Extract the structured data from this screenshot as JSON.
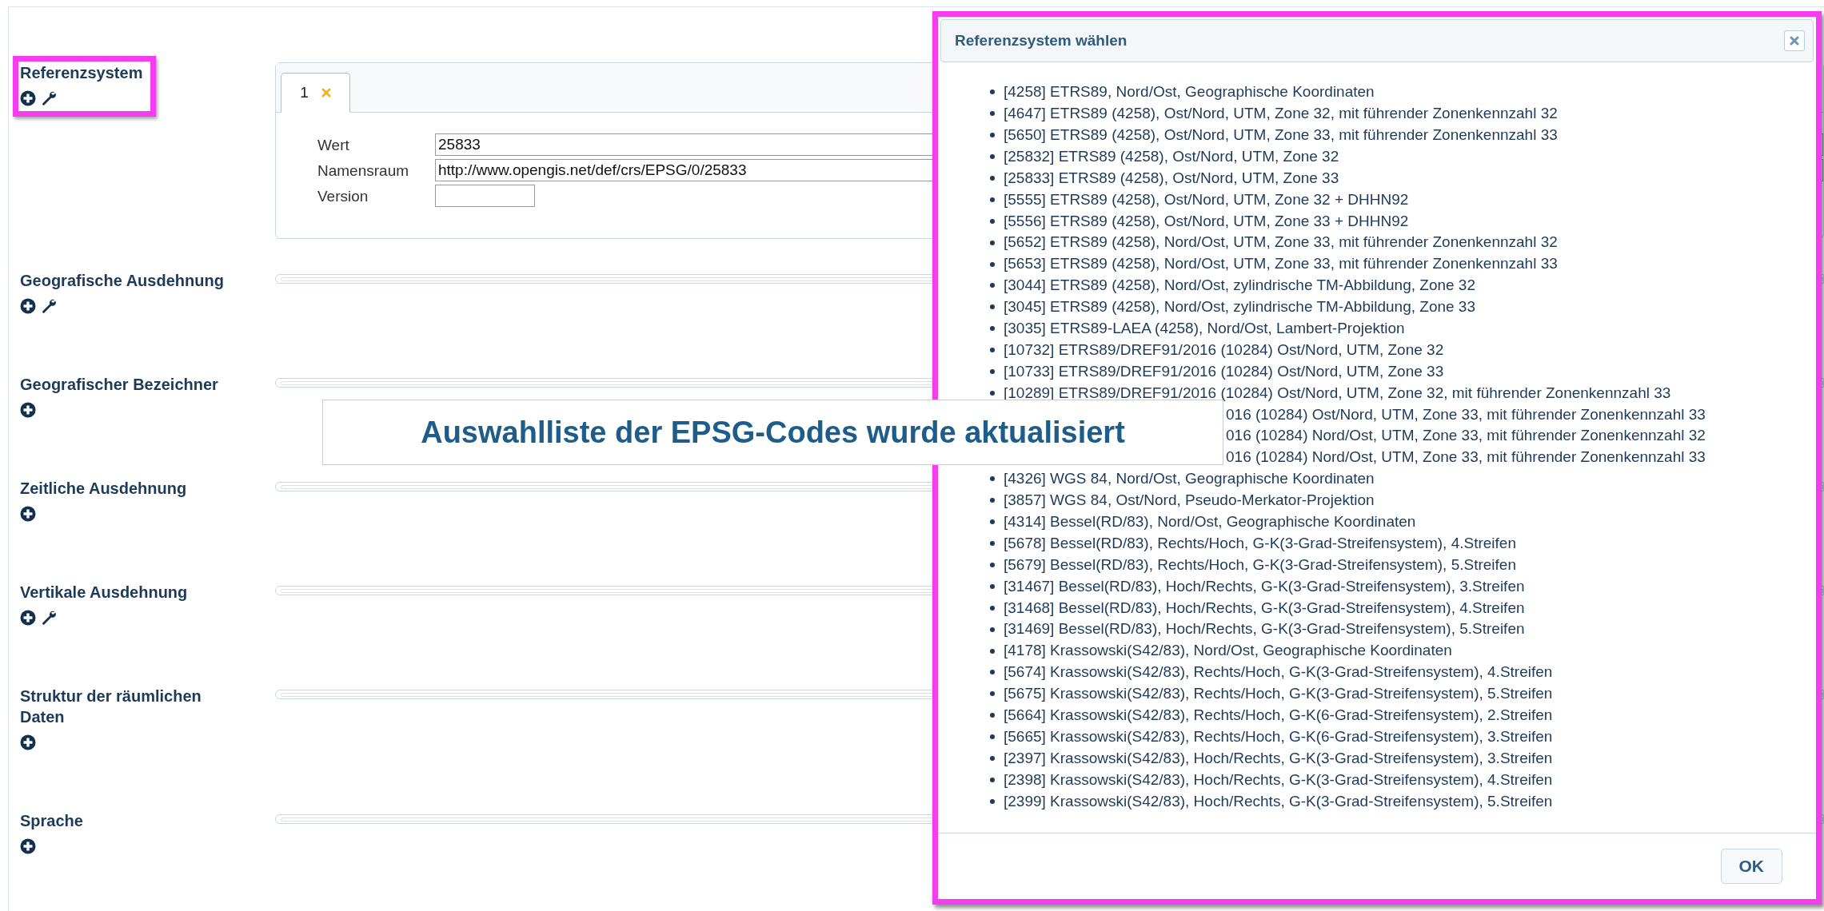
{
  "form": {
    "sections": [
      {
        "label": "Referenzsystem",
        "highlighted": true,
        "tools": [
          {
            "kind": "add"
          },
          {
            "kind": "edit"
          }
        ],
        "tabs": [
          {
            "label": "1",
            "selected": true
          }
        ],
        "fields": [
          {
            "label": "Wert",
            "value": "25833"
          },
          {
            "label": "Namensraum",
            "value": "http://www.opengis.net/def/crs/EPSG/0/25833"
          },
          {
            "label": "Version"
          }
        ]
      },
      {
        "label": "Geografische Ausdehnung",
        "highlighted": false,
        "tools": [
          {
            "kind": "add"
          },
          {
            "kind": "edit"
          }
        ]
      },
      {
        "label": "Geografischer Bezeichner",
        "highlighted": false,
        "tools": [
          {
            "kind": "add"
          }
        ]
      },
      {
        "label": "Zeitliche Ausdehnung",
        "highlighted": false,
        "tools": [
          {
            "kind": "add"
          }
        ]
      },
      {
        "label": "Vertikale Ausdehnung",
        "highlighted": false,
        "tools": [
          {
            "kind": "add"
          },
          {
            "kind": "edit"
          }
        ]
      },
      {
        "label": "Struktur der räumlichen Daten",
        "highlighted": false,
        "tools": [
          {
            "kind": "add"
          }
        ]
      },
      {
        "label": "Sprache",
        "highlighted": false,
        "tools": [
          {
            "kind": "add"
          }
        ]
      }
    ]
  },
  "dialog": {
    "title": "Referenzsystem wählen",
    "highlighted": true,
    "items": [
      {
        "kind": "entry",
        "text": "[4258] ETRS89, Nord/Ost, Geographische Koordinaten"
      },
      {
        "kind": "entry",
        "text": "[4647] ETRS89 (4258), Ost/Nord, UTM, Zone 32, mit führender Zonenkennzahl 32"
      },
      {
        "kind": "entry",
        "text": "[5650] ETRS89 (4258), Ost/Nord, UTM, Zone 33, mit führender Zonenkennzahl 33"
      },
      {
        "kind": "entry",
        "text": "[25832] ETRS89 (4258), Ost/Nord, UTM, Zone 32"
      },
      {
        "kind": "entry",
        "text": "[25833] ETRS89 (4258), Ost/Nord, UTM, Zone 33"
      },
      {
        "kind": "entry",
        "text": "[5555] ETRS89 (4258), Ost/Nord, UTM, Zone 32 + DHHN92"
      },
      {
        "kind": "entry",
        "text": "[5556] ETRS89 (4258), Ost/Nord, UTM, Zone 33 + DHHN92"
      },
      {
        "kind": "entry",
        "text": "[5652] ETRS89 (4258), Nord/Ost, UTM, Zone 33, mit führender Zonenkennzahl 32"
      },
      {
        "kind": "entry",
        "text": "[5653] ETRS89 (4258), Nord/Ost, UTM, Zone 33, mit führender Zonenkennzahl 33"
      },
      {
        "kind": "entry",
        "text": "[3044] ETRS89 (4258), Nord/Ost, zylindrische TM-Abbildung, Zone 32"
      },
      {
        "kind": "entry",
        "text": "[3045] ETRS89 (4258), Nord/Ost, zylindrische TM-Abbildung, Zone 33"
      },
      {
        "kind": "entry",
        "text": "[3035] ETRS89-LAEA (4258), Nord/Ost, Lambert-Projektion"
      },
      {
        "kind": "entry",
        "text": "[10732] ETRS89/DREF91/2016 (10284) Ost/Nord, UTM, Zone 32"
      },
      {
        "kind": "entry",
        "text": "[10733] ETRS89/DREF91/2016 (10284) Ost/Nord, UTM, Zone 33"
      },
      {
        "kind": "entry",
        "text": "[10289] ETRS89/DREF91/2016 (10284) Ost/Nord, UTM, Zone 32, mit führender Zonenkennzahl 33"
      },
      {
        "kind": "partial",
        "text": "016 (10284) Ost/Nord, UTM, Zone 33, mit führender Zonenkennzahl 33"
      },
      {
        "kind": "partial",
        "text": "016 (10284) Nord/Ost, UTM, Zone 33, mit führender Zonenkennzahl 32"
      },
      {
        "kind": "partial",
        "text": "016 (10284) Nord/Ost, UTM, Zone 33, mit führender Zonenkennzahl 33"
      },
      {
        "kind": "entry",
        "text": "[4326] WGS 84, Nord/Ost, Geographische Koordinaten"
      },
      {
        "kind": "entry",
        "text": "[3857] WGS 84, Ost/Nord, Pseudo-Merkator-Projektion"
      },
      {
        "kind": "entry",
        "text": "[4314] Bessel(RD/83), Nord/Ost, Geographische Koordinaten"
      },
      {
        "kind": "entry",
        "text": "[5678] Bessel(RD/83), Rechts/Hoch, G-K(3-Grad-Streifensystem), 4.Streifen"
      },
      {
        "kind": "entry",
        "text": "[5679] Bessel(RD/83), Rechts/Hoch, G-K(3-Grad-Streifensystem), 5.Streifen"
      },
      {
        "kind": "entry",
        "text": "[31467] Bessel(RD/83), Hoch/Rechts, G-K(3-Grad-Streifensystem), 3.Streifen"
      },
      {
        "kind": "entry",
        "text": "[31468] Bessel(RD/83), Hoch/Rechts, G-K(3-Grad-Streifensystem), 4.Streifen"
      },
      {
        "kind": "entry",
        "text": "[31469] Bessel(RD/83), Hoch/Rechts, G-K(3-Grad-Streifensystem), 5.Streifen"
      },
      {
        "kind": "entry",
        "text": "[4178] Krassowski(S42/83), Nord/Ost, Geographische Koordinaten"
      },
      {
        "kind": "entry",
        "text": "[5674] Krassowski(S42/83), Rechts/Hoch, G-K(3-Grad-Streifensystem), 4.Streifen"
      },
      {
        "kind": "entry",
        "text": "[5675] Krassowski(S42/83), Rechts/Hoch, G-K(3-Grad-Streifensystem), 5.Streifen"
      },
      {
        "kind": "entry",
        "text": "[5664] Krassowski(S42/83), Rechts/Hoch, G-K(6-Grad-Streifensystem), 2.Streifen"
      },
      {
        "kind": "entry",
        "text": "[5665] Krassowski(S42/83), Rechts/Hoch, G-K(6-Grad-Streifensystem), 3.Streifen"
      },
      {
        "kind": "entry",
        "text": "[2397] Krassowski(S42/83), Hoch/Rechts, G-K(3-Grad-Streifensystem), 3.Streifen"
      },
      {
        "kind": "entry",
        "text": "[2398] Krassowski(S42/83), Hoch/Rechts, G-K(3-Grad-Streifensystem), 4.Streifen"
      },
      {
        "kind": "entry",
        "text": "[2399] Krassowski(S42/83), Hoch/Rechts, G-K(3-Grad-Streifensystem), 5.Streifen"
      }
    ],
    "buttons": [
      "OK"
    ]
  },
  "banner": {
    "text": "Auswahlliste der EPSG-Codes wurde aktualisiert"
  }
}
